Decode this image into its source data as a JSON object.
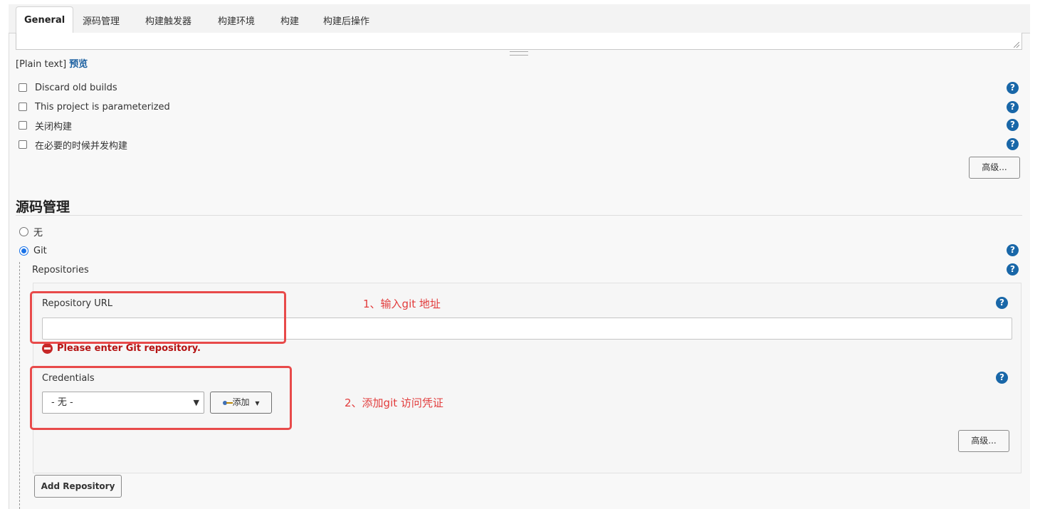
{
  "tabs": [
    "General",
    "源码管理",
    "构建触发器",
    "构建环境",
    "构建",
    "构建后操作"
  ],
  "description": {
    "plain_text_label": "[Plain text]",
    "preview_link": "预览"
  },
  "general_options": [
    {
      "label": "Discard old builds",
      "checked": false
    },
    {
      "label": "This project is parameterized",
      "checked": false
    },
    {
      "label": "关闭构建",
      "checked": false
    },
    {
      "label": "在必要的时候并发构建",
      "checked": false
    }
  ],
  "advanced_label": "高级...",
  "scm": {
    "title": "源码管理",
    "options": [
      {
        "label": "无",
        "selected": false
      },
      {
        "label": "Git",
        "selected": true
      }
    ],
    "repositories_label": "Repositories",
    "repository_url_label": "Repository URL",
    "repository_url_value": "",
    "error_message": "Please enter Git repository.",
    "credentials_label": "Credentials",
    "credentials_selected": "- 无 -",
    "add_button_label": "添加",
    "repo_advanced_label": "高级...",
    "add_repository_label": "Add Repository"
  },
  "annotations": {
    "step1": "1、输入git 地址",
    "step2": "2、添加git 访问凭证"
  },
  "colors": {
    "help": "#1967a8",
    "error": "#b51212",
    "highlight": "#e84a4a"
  }
}
